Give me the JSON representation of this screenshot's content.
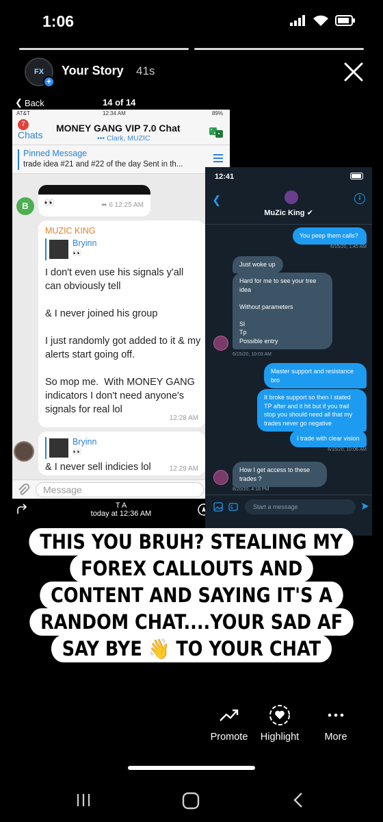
{
  "status_bar": {
    "time": "1:06"
  },
  "story": {
    "title": "Your Story",
    "age": "41s",
    "avatar_text": "FX"
  },
  "shot1": {
    "back_label": "Back",
    "count": "14 of 14",
    "device_status": {
      "carrier": "AT&T",
      "time": "12:34 AM",
      "battery": "89%"
    },
    "unread_badge": "7",
    "chats_label": "Chats",
    "chat_title": "MONEY GANG VIP 7.0 Chat",
    "members": "••• Clark, MUZIC",
    "pinned_label": "Pinned Message",
    "pinned_text": "trade idea #21 and #22 of the day Sent in th...",
    "avatar_b": "B",
    "msg1": {
      "eyes": "👀",
      "meta": "6  12:25 AM"
    },
    "msg2": {
      "sender": "MUZIC KING",
      "reply_name": "Bryinn",
      "reply_eyes": "👀",
      "text": "I don't even use his signals y'all can obviously tell\n\n& I never joined his group\n\nI just randomly got added to it & my alerts start going off.\n\nSo mop me.  With MONEY GANG indicators I don't need anyone's signals for real lol",
      "time": "12:28 AM"
    },
    "msg3": {
      "reply_name": "Bryinn",
      "reply_eyes": "👀",
      "text": "& I never sell indicies lol",
      "time": "12:29 AM"
    },
    "input_placeholder": "Message",
    "footer_name": "T A",
    "footer_time": "today at 12:36 AM"
  },
  "shot2": {
    "time": "12:41",
    "contact_name": "MuZic King",
    "messages": [
      {
        "dir": "out",
        "text": "You peep them calls?"
      },
      {
        "dir": "meta",
        "text": "6/15/20, 1:45 AM"
      },
      {
        "dir": "in",
        "text": "Just woke up"
      },
      {
        "dir": "in",
        "text": "Hard for me to see your tree idea\n\nWithout parameters\n\nSl\nTp\nPossible entry"
      },
      {
        "dir": "meta",
        "text": "6/15/20, 10:03 AM"
      },
      {
        "dir": "out",
        "text": "Master support and resistance bro"
      },
      {
        "dir": "out",
        "text": "It broke support so then I stated TP after and it hit but if you trail stop you should need all that my trades never go negative"
      },
      {
        "dir": "out",
        "text": "I trade with clear vision"
      },
      {
        "dir": "meta",
        "text": "6/15/20, 10:06 AM"
      },
      {
        "dir": "in",
        "text": "How I get access to these trades ?"
      },
      {
        "dir": "meta",
        "text": "8/20/20, 4:18 PM"
      }
    ],
    "compose_placeholder": "Start a message"
  },
  "caption": {
    "lines": [
      "THIS YOU BRUH? STEALING MY",
      "FOREX CALLOUTS AND",
      "CONTENT AND SAYING IT'S A",
      "RANDOM CHAT....YOUR SAD AF",
      "SAY BYE 👋 TO YOUR CHAT"
    ]
  },
  "actions": {
    "promote": "Promote",
    "highlight": "Highlight",
    "more": "More"
  },
  "colors": {
    "telegram_blue": "#2a81d6",
    "twitter_blue": "#1d9bf0",
    "dm_in": "#3d5466",
    "dark_bg": "#15202b"
  }
}
